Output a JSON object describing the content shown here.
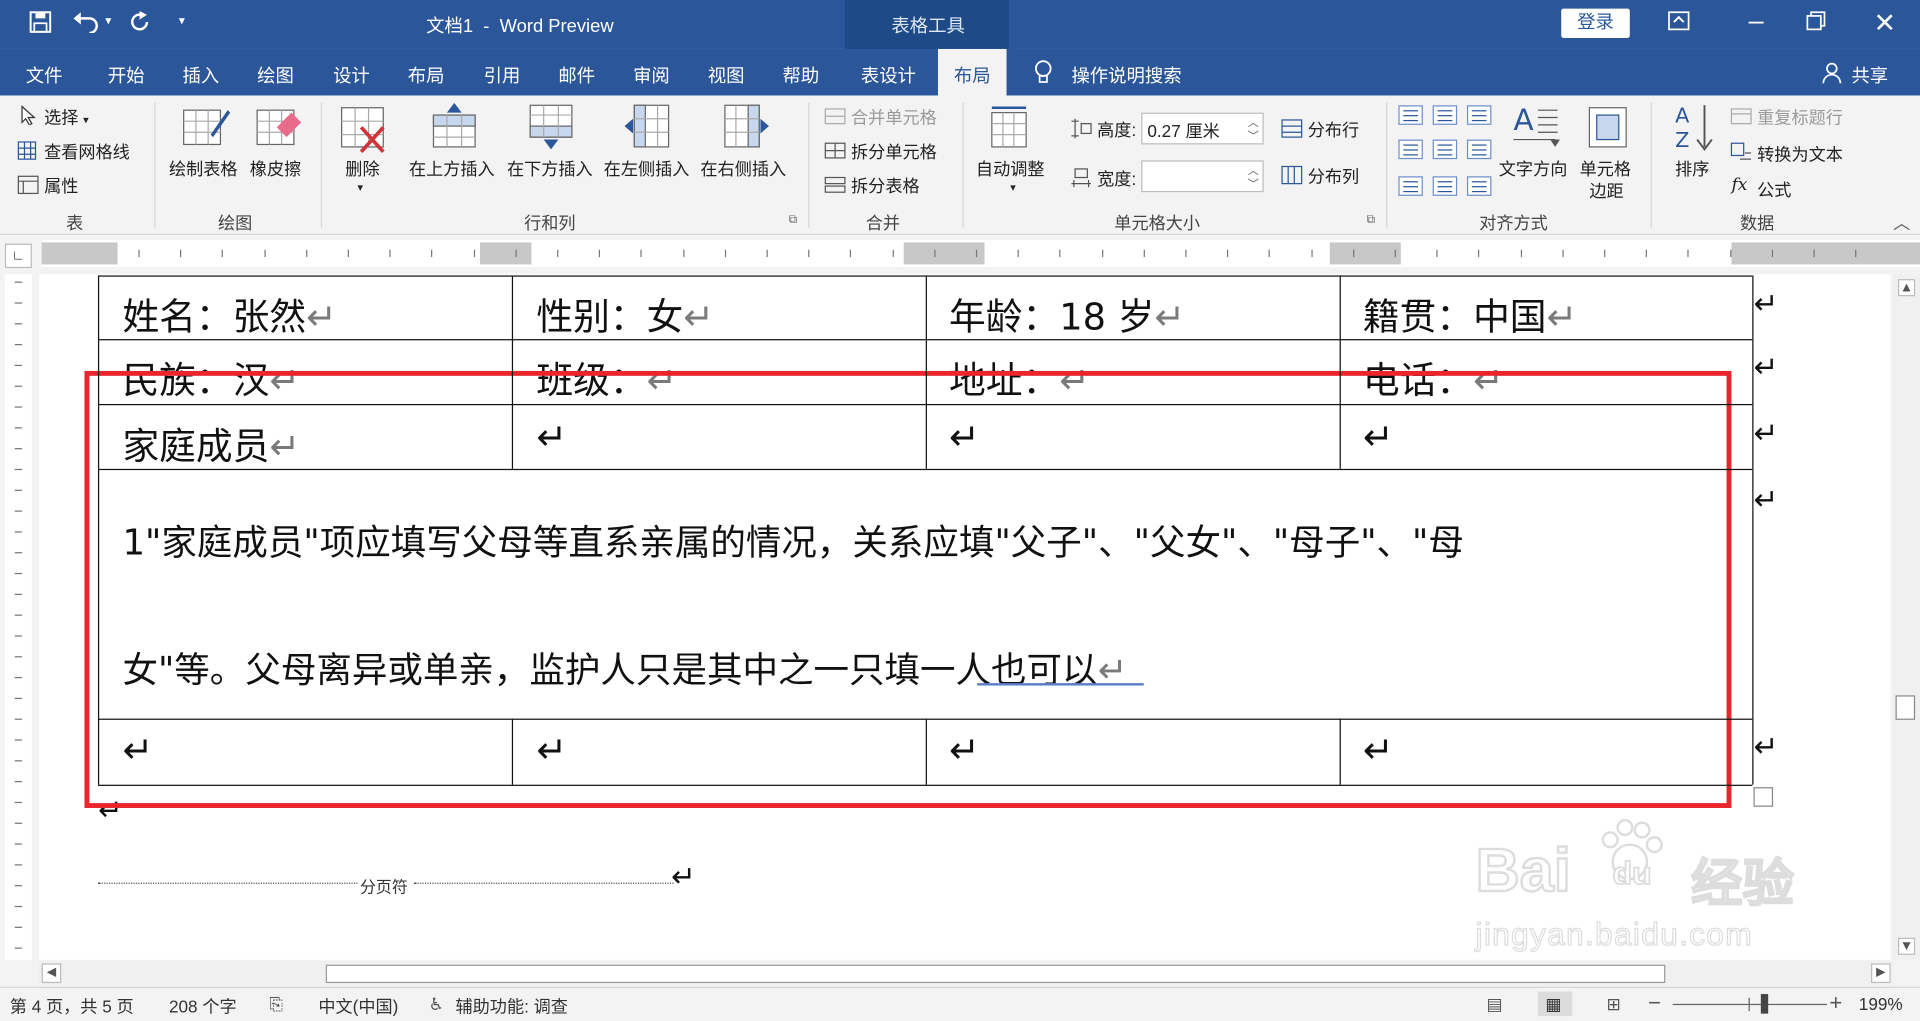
{
  "title": {
    "doc": "文档1",
    "sep": "-",
    "app": "Word Preview",
    "context": "表格工具",
    "login": "登录"
  },
  "tabs": [
    "文件",
    "开始",
    "插入",
    "绘图",
    "设计",
    "布局",
    "引用",
    "邮件",
    "审阅",
    "视图",
    "帮助",
    "表设计",
    "布局"
  ],
  "tell_me": "操作说明搜索",
  "share": "共享",
  "ribbon": {
    "table": {
      "select": "选择",
      "gridlines": "查看网格线",
      "properties": "属性",
      "group": "表"
    },
    "draw": {
      "draw_table": "绘制表格",
      "eraser": "橡皮擦",
      "group": "绘图"
    },
    "rows_cols": {
      "delete": "删除",
      "insert_above": "在上方插入",
      "insert_below": "在下方插入",
      "insert_left": "在左侧插入",
      "insert_right": "在右侧插入",
      "group": "行和列"
    },
    "merge": {
      "merge_cells": "合并单元格",
      "split_cells": "拆分单元格",
      "split_table": "拆分表格",
      "group": "合并"
    },
    "cell_size": {
      "autofit": "自动调整",
      "height_label": "高度:",
      "height_value": "0.27 厘米",
      "width_label": "宽度:",
      "width_value": "",
      "dist_rows": "分布行",
      "dist_cols": "分布列",
      "group": "单元格大小"
    },
    "alignment": {
      "text_direction": "文字方向",
      "cell_margins_1": "单元格",
      "cell_margins_2": "边距",
      "group": "对齐方式"
    },
    "data": {
      "sort": "排序",
      "repeat_header": "重复标题行",
      "convert": "转换为文本",
      "formula": "公式",
      "group": "数据"
    }
  },
  "document": {
    "row1": [
      "姓名：张然",
      "性别：女",
      "年龄：18 岁",
      "籍贯：中国"
    ],
    "row2": [
      "民族：汉",
      "班级：",
      "地址：",
      "电话："
    ],
    "row3": [
      "家庭成员",
      "",
      "",
      ""
    ],
    "note_line1": "1\"家庭成员\"项应填写父母等直系亲属的情况，关系应填\"父子\"、\"父女\"、\"母子\"、\"母",
    "note_line2": "女\"等。父母离异或单亲，监护人只是其中之一只填一人也可以",
    "page_break": "分页符",
    "return_mark": "↵"
  },
  "status": {
    "page": "第 4 页，共 5 页",
    "words": "208 个字",
    "lang": "中文(中国)",
    "accessibility": "辅助功能: 调查",
    "zoom": "199%"
  },
  "watermark": {
    "text1": "Bai",
    "text2": "du",
    "text3": "经验",
    "url": "jingyan.baidu.com"
  },
  "colors": {
    "brand": "#2b579a",
    "highlight": "#e8262c"
  }
}
